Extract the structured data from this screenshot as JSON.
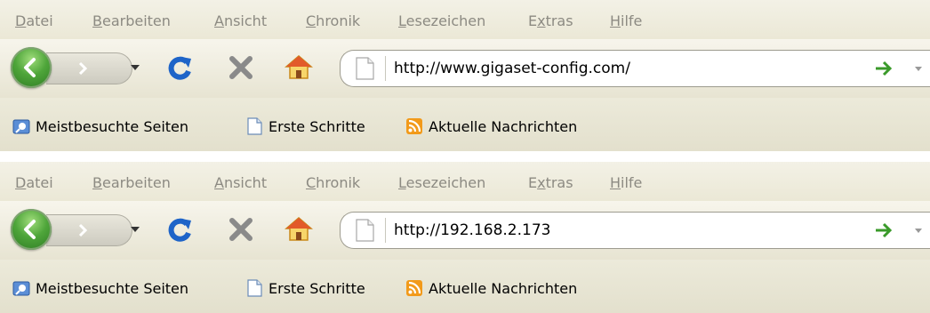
{
  "browsers": [
    {
      "menu": [
        {
          "pre": "",
          "acc": "D",
          "post": "atei"
        },
        {
          "pre": "",
          "acc": "B",
          "post": "earbeiten"
        },
        {
          "pre": "",
          "acc": "A",
          "post": "nsicht"
        },
        {
          "pre": "",
          "acc": "C",
          "post": "hronik"
        },
        {
          "pre": "",
          "acc": "L",
          "post": "esezeichen"
        },
        {
          "pre": "E",
          "acc": "x",
          "post": "tras"
        },
        {
          "pre": "",
          "acc": "H",
          "post": "ilfe"
        }
      ],
      "url": "http://www.gigaset-config.com/",
      "bookmarks": [
        "Meistbesuchte Seiten",
        "Erste Schritte",
        "Aktuelle Nachrichten"
      ]
    },
    {
      "menu": [
        {
          "pre": "",
          "acc": "D",
          "post": "atei"
        },
        {
          "pre": "",
          "acc": "B",
          "post": "earbeiten"
        },
        {
          "pre": "",
          "acc": "A",
          "post": "nsicht"
        },
        {
          "pre": "",
          "acc": "C",
          "post": "hronik"
        },
        {
          "pre": "",
          "acc": "L",
          "post": "esezeichen"
        },
        {
          "pre": "E",
          "acc": "x",
          "post": "tras"
        },
        {
          "pre": "",
          "acc": "H",
          "post": "ilfe"
        }
      ],
      "url": "http://192.168.2.173",
      "bookmarks": [
        "Meistbesuchte Seiten",
        "Erste Schritte",
        "Aktuelle Nachrichten"
      ]
    }
  ],
  "icons": {
    "back": "back-arrow-icon",
    "forward": "forward-arrow-icon",
    "reload": "reload-icon",
    "stop": "stop-icon",
    "home": "home-icon",
    "page": "page-icon",
    "go": "go-arrow-icon",
    "most_visited": "smart-bookmark-icon",
    "first_steps": "page-icon",
    "rss": "rss-feed-icon"
  },
  "colors": {
    "chrome_bg": "#ece9d8",
    "menu_text": "#8c8a82",
    "back_green": "#4ea53a",
    "reload_blue": "#1e64c8",
    "stop_gray": "#8a8a8a",
    "go_green": "#3a9a2a",
    "rss_orange": "#f29a1a"
  }
}
